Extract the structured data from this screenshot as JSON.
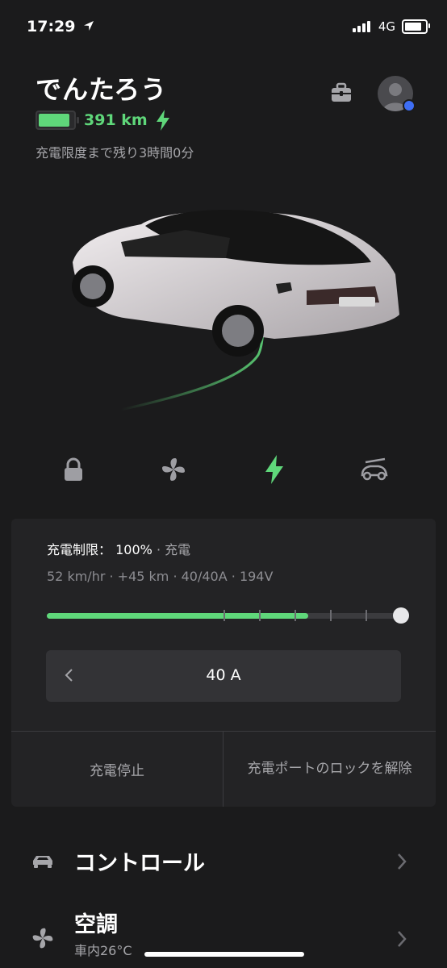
{
  "status_bar": {
    "time": "17:29",
    "network": "4G",
    "icons": [
      "location-arrow-icon",
      "signal-icon",
      "battery-icon"
    ]
  },
  "header": {
    "car_name": "でんたろう",
    "range": "391 km",
    "battery_level": 1.0,
    "charge_remaining": "充電限度まで残り3時間0分",
    "icons": [
      "toolbox-icon",
      "avatar"
    ]
  },
  "quick_actions": {
    "icons": [
      "lock-icon",
      "fan-icon",
      "charging-bolt-icon",
      "summon-icon"
    ],
    "active": "charging-bolt-icon",
    "accent_color": "#5fd77a"
  },
  "charging": {
    "limit_label": "充電制限：",
    "limit_value": "100%",
    "limit_sep": "·",
    "status": "充電",
    "stats": "52 km/hr · +45 km · 40/40A · 194V",
    "current_level": 0.74,
    "limit_level": 1.0,
    "amperage": "40 A",
    "stop_label": "充電停止",
    "unlock_port_label": "充電ポートのロックを解除"
  },
  "menu": {
    "items": [
      {
        "title": "コントロール",
        "subtitle": "",
        "icon": "car-icon"
      },
      {
        "title": "空調",
        "subtitle": "車内26°C",
        "icon": "fan-icon"
      }
    ]
  },
  "colors": {
    "background": "#1b1b1c",
    "card": "#232325",
    "accent_green": "#5fd77a",
    "avatar_dot": "#3e6ef5"
  }
}
